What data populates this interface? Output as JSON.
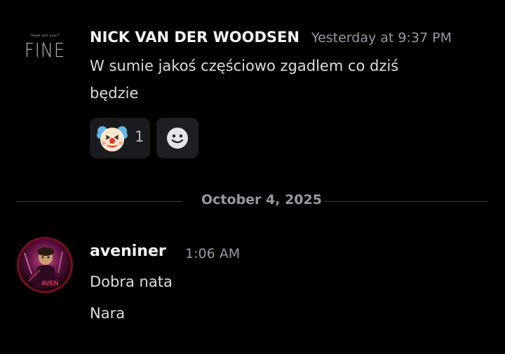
{
  "messages": [
    {
      "author": "NICK VAN DER WOODSEN",
      "timestamp": "Yesterday at 9:37 PM",
      "avatar": {
        "small_text": "\"Heat are you?\"",
        "big_text": "FINE"
      },
      "lines": [
        "W sumie jakoś częściowo zgadlem co dziś",
        "będzie"
      ],
      "reactions": [
        {
          "emoji": "clown-face-icon",
          "count": "1"
        },
        {
          "emoji": "add-reaction-smiley-icon"
        }
      ]
    },
    {
      "author": "aveniner",
      "timestamp": "1:06 AM",
      "avatar": {
        "label": "AVEN"
      },
      "lines": [
        "Dobra nata",
        "Nara"
      ]
    }
  ],
  "divider": {
    "date": "October 4, 2025"
  },
  "colors": {
    "background": "#000000",
    "username": "#f2f3f5",
    "timestamp": "#949ba4",
    "text": "#dbdee1",
    "reaction_bg": "#1e1f22",
    "divider_line": "#3f4147"
  }
}
